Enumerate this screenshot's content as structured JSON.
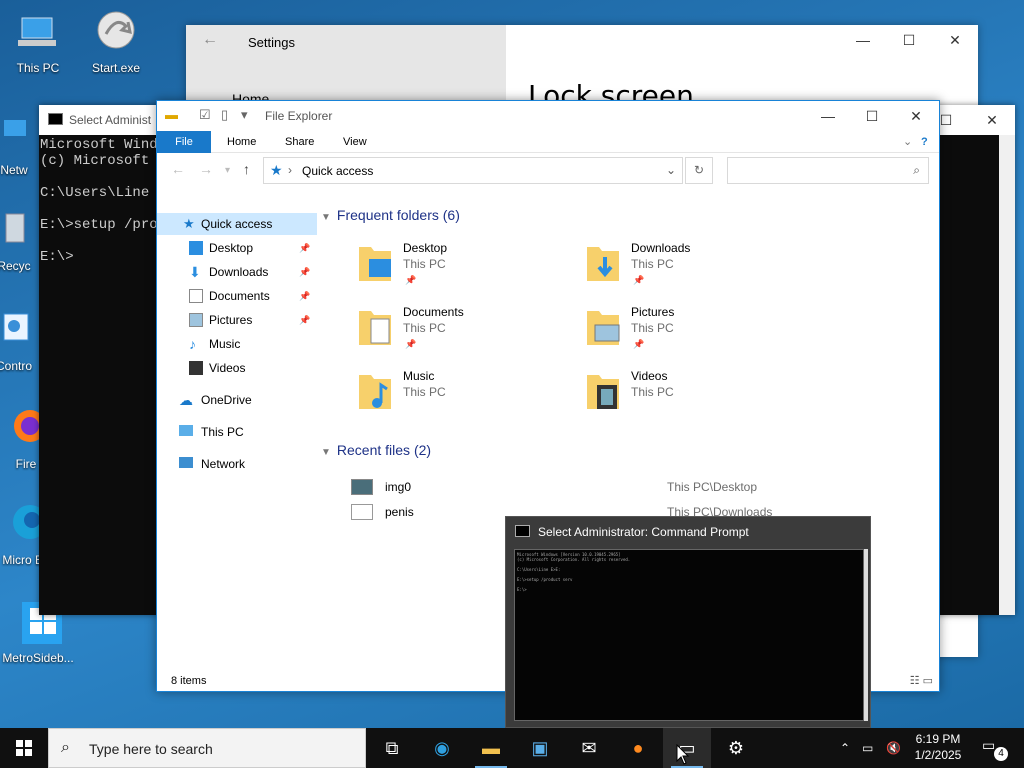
{
  "desktop": {
    "icons": [
      "This PC",
      "Start.exe",
      "Netw",
      "Recyc",
      "Contro",
      "Fire",
      "Micro Ed",
      "MetroSideb..."
    ]
  },
  "settings": {
    "title": "Settings",
    "home": "Home",
    "heading": "Lock screen"
  },
  "cmd_back": {
    "title": "Select Administ",
    "lines": "Microsoft Windo\n(c) Microsoft C\n\nC:\\Users\\Line E\n\nE:\\>setup /proc\n\nE:\\>"
  },
  "explorer": {
    "title": "File Explorer",
    "ribbon": {
      "file": "File",
      "home": "Home",
      "share": "Share",
      "view": "View"
    },
    "address": "Quick access",
    "nav": {
      "quick_access": "Quick access",
      "desktop": "Desktop",
      "downloads": "Downloads",
      "documents": "Documents",
      "pictures": "Pictures",
      "music": "Music",
      "videos": "Videos",
      "onedrive": "OneDrive",
      "thispc": "This PC",
      "network": "Network"
    },
    "frequent_header": "Frequent folders (6)",
    "folders": [
      {
        "name": "Desktop",
        "loc": "This PC"
      },
      {
        "name": "Downloads",
        "loc": "This PC"
      },
      {
        "name": "Documents",
        "loc": "This PC"
      },
      {
        "name": "Pictures",
        "loc": "This PC"
      },
      {
        "name": "Music",
        "loc": "This PC"
      },
      {
        "name": "Videos",
        "loc": "This PC"
      }
    ],
    "recent_header": "Recent files (2)",
    "recent": [
      {
        "name": "img0",
        "loc": "This PC\\Desktop"
      },
      {
        "name": "penis",
        "loc": "This PC\\Downloads"
      }
    ],
    "status": "8 items"
  },
  "preview": {
    "title": "Select Administrator: Command Prompt",
    "lines": "Microsoft Windows [Version 10.0.19045.2965]\n(c) Microsoft Corporation. All rights reserved.\n\nC:\\Users\\Line E>E:\n\nE:\\>setup /product serv\n\nE:\\>"
  },
  "taskbar": {
    "search_placeholder": "Type here to search",
    "time": "6:19 PM",
    "date": "1/2/2025",
    "notifications": "4"
  }
}
